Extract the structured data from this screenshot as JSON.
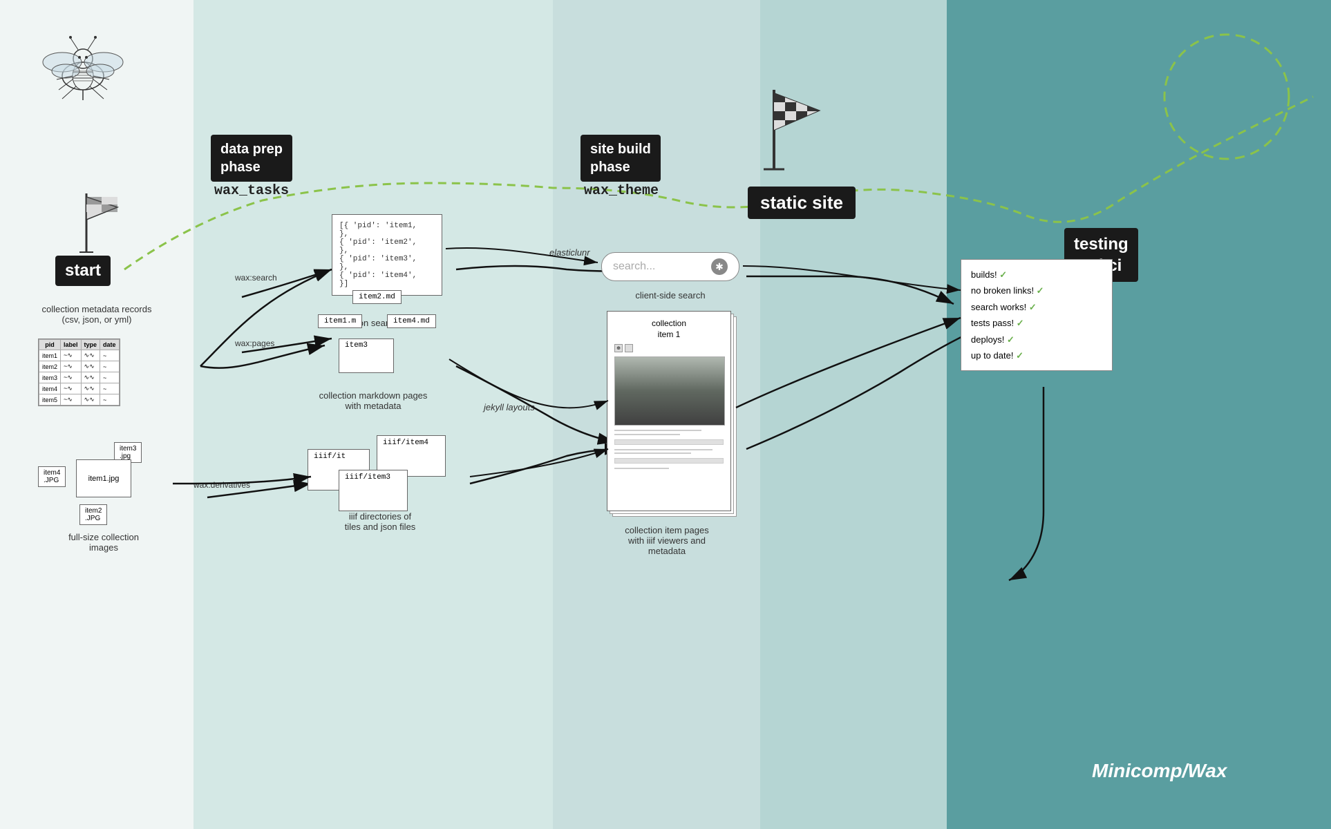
{
  "background": {
    "col1": "#f0f5f4",
    "col2": "#d4e8e5",
    "col3": "#c0dbd8",
    "col4": "#5d9ea0"
  },
  "phases": {
    "data_prep": {
      "label": "data prep\nphase",
      "sublabel": "wax_tasks"
    },
    "site_build": {
      "label": "site build\nphase",
      "sublabel": "wax_theme"
    },
    "static_site": {
      "label": "static site"
    },
    "testing": {
      "label": "testing\nand ci"
    }
  },
  "start_label": "start",
  "arrow_labels": {
    "wax_search": "wax:search",
    "wax_pages": "wax:pages",
    "wax_derivatives": "wax:derivatives",
    "elasticlunr": "elasticlunr",
    "jekyll_layouts": "jekyll layouts"
  },
  "json_doc": {
    "lines": [
      "[{ 'pid': 'item1,",
      "},",
      "{ 'pid': 'item2',",
      "},",
      "{ 'pid': 'item3',",
      "},",
      "{ 'pid': 'item4',",
      "}]"
    ],
    "label": "json search index"
  },
  "metadata_table": {
    "headers": [
      "pid",
      "label",
      "type",
      "date"
    ],
    "rows": [
      [
        "item1",
        "~",
        "∿∿",
        "~"
      ],
      [
        "item2",
        "~",
        "∿∿",
        "~"
      ],
      [
        "item3",
        "~",
        "∿∿",
        "~"
      ],
      [
        "item4",
        "~",
        "∿∿",
        "~"
      ],
      [
        "item5",
        "~",
        "∿∿",
        "~"
      ]
    ],
    "label": "collection metadata records\n(csv, json, or yml)"
  },
  "search_box": {
    "placeholder": "search...",
    "label": "client-side search"
  },
  "checklist": {
    "items": [
      {
        "text": "builds!",
        "check": true
      },
      {
        "text": "no broken links!",
        "check": true
      },
      {
        "text": "search works!",
        "check": true
      },
      {
        "text": "tests pass!",
        "check": true
      },
      {
        "text": "deploys!",
        "check": true
      },
      {
        "text": "up to date!",
        "check": true
      }
    ]
  },
  "collection_item": {
    "title": "collection\nitem 1",
    "label": "collection item pages\nwith iiif viewers and\nmetadata"
  },
  "markdown_files": {
    "files": [
      "item2.md",
      "item1.m",
      "item4.md",
      "item3"
    ],
    "label": "collection markdown pages\nwith metadata"
  },
  "iiif_dirs": {
    "folders": [
      "iiif/it",
      "iiif/item4",
      "iiif/item3"
    ],
    "label": "iiif directories of\ntiles and json files"
  },
  "image_files": {
    "files": [
      "item3\n.jpg",
      "item4\n.JPG",
      "item1.jpg",
      "item2\n.JPG"
    ],
    "label": "full-size collection\nimages"
  },
  "branding": "Minicomp/Wax"
}
